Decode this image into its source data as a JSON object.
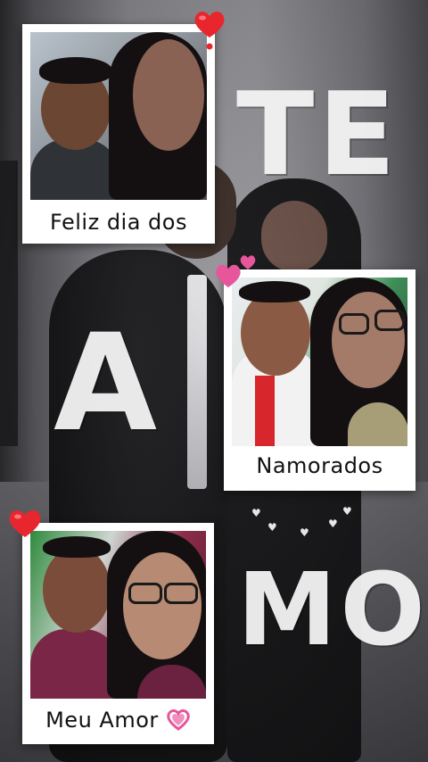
{
  "captions": {
    "top": "Feliz dia dos",
    "middle": "Namorados",
    "bottom": "Meu Amor"
  },
  "big_words": {
    "first": "TE",
    "second": "A",
    "third": "MO"
  },
  "icons": {
    "heart_top": "red-heart-icon",
    "heart_middle": "pink-two-hearts-icon",
    "heart_bottom": "red-heart-icon",
    "heart_caption": "pink-heart-icon"
  },
  "colors": {
    "red_heart": "#e8262e",
    "pink_heart": "#e7559a",
    "polaroid": "#ffffff",
    "word": "#f4f4f4"
  }
}
